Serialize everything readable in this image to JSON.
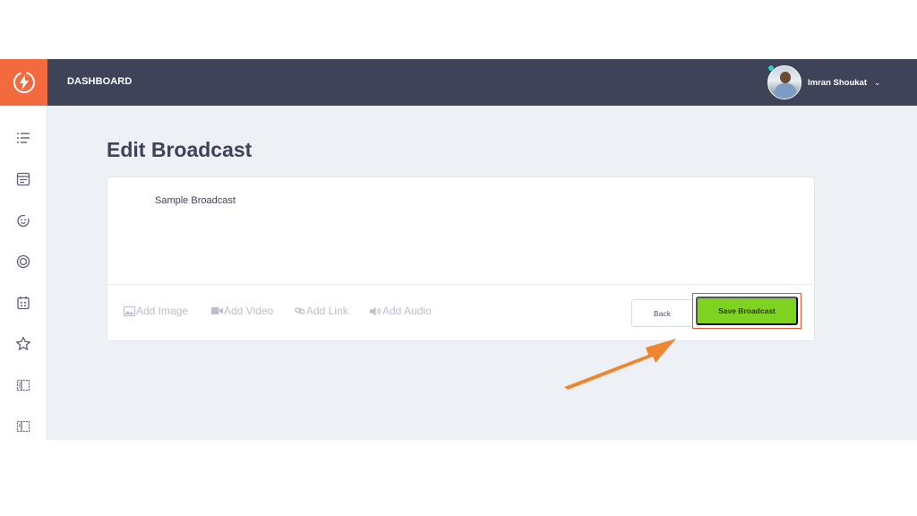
{
  "header": {
    "title": "DASHBOARD",
    "user_name": "Imran Shoukat",
    "user_chevron": "⌄"
  },
  "sidebar": {
    "items": [
      {
        "icon": "list-icon"
      },
      {
        "icon": "broadcast-list-icon"
      },
      {
        "icon": "smiley-icon"
      },
      {
        "icon": "target-icon"
      },
      {
        "icon": "calendar-icon"
      },
      {
        "icon": "star-icon"
      },
      {
        "icon": "layout-icon"
      },
      {
        "icon": "layout-alt-icon"
      }
    ]
  },
  "main": {
    "page_title": "Edit Broadcast",
    "editor_text": "Sample Broadcast",
    "attachments": {
      "image": "Add Image",
      "video": "Add Video",
      "link": "Add Link",
      "audio": "Add Audio"
    },
    "back_label": "Back",
    "save_label": "Save Broadcast"
  },
  "colors": {
    "topbar": "#3f4357",
    "logo_bg": "#f26a3d",
    "save_button": "#7ed321",
    "highlight": "#e4572e",
    "arrow": "#f0852f"
  }
}
